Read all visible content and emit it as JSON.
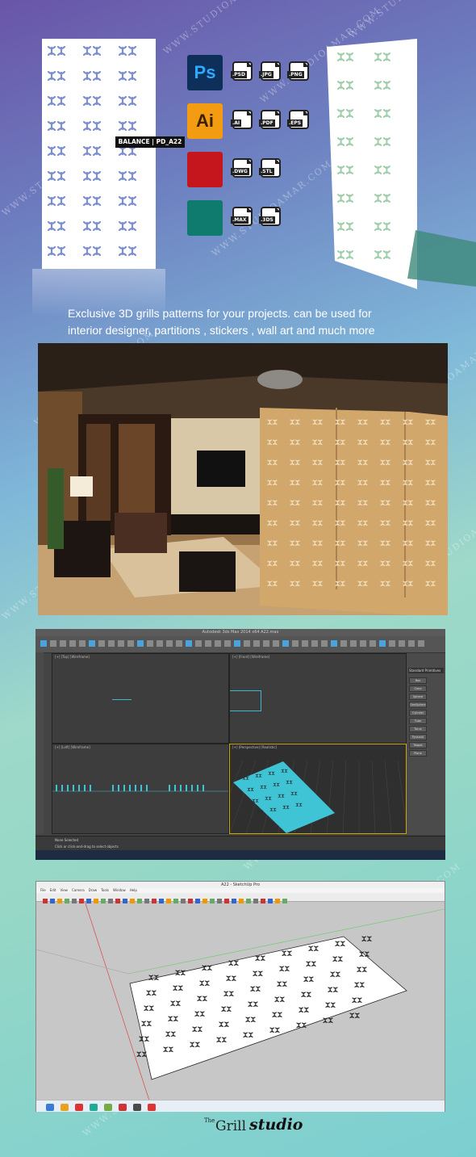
{
  "panel_label": "BALANCE | PD_A22",
  "watermark": "WWW.STUDIOAMAR.COM",
  "apps": [
    {
      "name": "photoshop-icon",
      "text": "Ps",
      "bg": "#0d2f5a",
      "fg": "#30a8ff",
      "formats": [
        ".PSD",
        ".JPG",
        ".PNG"
      ]
    },
    {
      "name": "illustrator-icon",
      "text": "Ai",
      "bg": "#f39c12",
      "fg": "#3a1f00",
      "formats": [
        ".AI",
        ".PDF",
        ".EPS"
      ]
    },
    {
      "name": "autocad-icon",
      "text": "",
      "bg": "#c4161c",
      "fg": "#fff",
      "formats": [
        ".DWG",
        ".STL"
      ]
    },
    {
      "name": "3dsmax-icon",
      "text": "",
      "bg": "#0f7a6e",
      "fg": "#fff",
      "formats": [
        ".MAX",
        ".3DS"
      ]
    }
  ],
  "caption_line1": "Exclusive  3D grills patterns for your projects.  can be used for",
  "caption_line2": "interior designer, partitions , stickers , wall art and much more",
  "max_window_title": "Autodesk 3ds Max 2014 x64    A22.max",
  "max_viewports": [
    "[+] [Top] [Wireframe]",
    "[+] [Front] [Wireframe]",
    "[+] [Left] [Wireframe]",
    "[+] [Perspective] [Realistic]"
  ],
  "max_panel_title": "Standard Primitives",
  "max_buttons": [
    "Box",
    "Cone",
    "Sphere",
    "GeoSphere",
    "Cylinder",
    "Tube",
    "Torus",
    "Pyramid",
    "Teapot",
    "Plane"
  ],
  "max_status": "None Selected",
  "max_hint": "Click or click-and-drag to select objects",
  "sketchup_title": "A22 - SketchUp Pro",
  "sketchup_menu": [
    "File",
    "Edit",
    "View",
    "Camera",
    "Draw",
    "Tools",
    "Window",
    "Help"
  ],
  "logo_the": "The",
  "logo_grill": "Grill",
  "logo_studio": "studio",
  "colors": {
    "accent": "#3fc4d6",
    "max_bg": "#444444",
    "sketchup_bg": "#c7c7c7"
  }
}
